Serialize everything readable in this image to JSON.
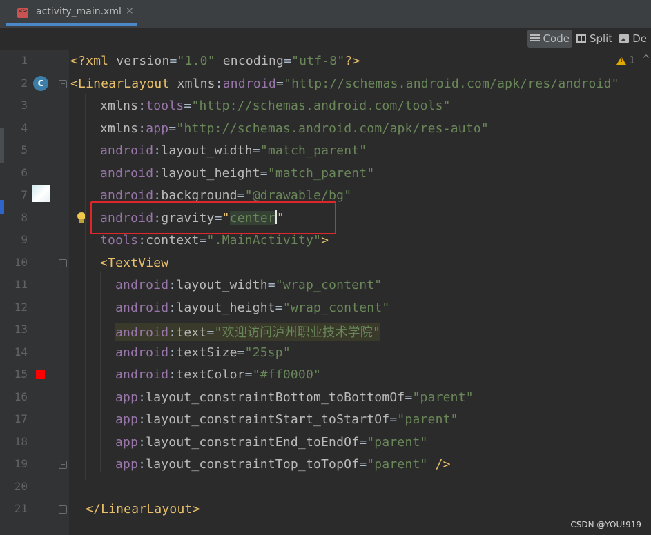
{
  "tab": {
    "filename": "activity_main.xml",
    "close": "×"
  },
  "modes": {
    "code": "Code",
    "split": "Split",
    "design": "De"
  },
  "warnings": {
    "count": "1",
    "nav": "^"
  },
  "lines": [
    {
      "n": "1",
      "tokens": [
        [
          "tk-tag",
          "<?xml "
        ],
        [
          "tk-attr",
          "version"
        ],
        [
          "tk-punc",
          "="
        ],
        [
          "tk-val",
          "\"1.0\""
        ],
        [
          "tk-attr",
          " encoding"
        ],
        [
          "tk-punc",
          "="
        ],
        [
          "tk-val",
          "\"utf-8\""
        ],
        [
          "tk-tag",
          "?>"
        ]
      ]
    },
    {
      "n": "2",
      "tokens": [
        [
          "tk-tag",
          "<LinearLayout "
        ],
        [
          "tk-attr",
          "xmlns"
        ],
        [
          "tk-punc",
          ":"
        ],
        [
          "tk-ns",
          "android"
        ],
        [
          "tk-punc",
          "="
        ],
        [
          "tk-val",
          "\"http://schemas.android.com/apk/res/android\""
        ]
      ]
    },
    {
      "n": "3",
      "tokens": [
        [
          "tk-attr",
          "xmlns"
        ],
        [
          "tk-punc",
          ":"
        ],
        [
          "tk-ns",
          "tools"
        ],
        [
          "tk-punc",
          "="
        ],
        [
          "tk-val",
          "\"http://schemas.android.com/tools\""
        ]
      ]
    },
    {
      "n": "4",
      "tokens": [
        [
          "tk-attr",
          "xmlns"
        ],
        [
          "tk-punc",
          ":"
        ],
        [
          "tk-ns",
          "app"
        ],
        [
          "tk-punc",
          "="
        ],
        [
          "tk-val",
          "\"http://schemas.android.com/apk/res-auto\""
        ]
      ]
    },
    {
      "n": "5",
      "tokens": [
        [
          "tk-ns",
          "android"
        ],
        [
          "tk-punc",
          ":"
        ],
        [
          "tk-attr",
          "layout_width"
        ],
        [
          "tk-punc",
          "="
        ],
        [
          "tk-val",
          "\"match_parent\""
        ]
      ]
    },
    {
      "n": "6",
      "tokens": [
        [
          "tk-ns",
          "android"
        ],
        [
          "tk-punc",
          ":"
        ],
        [
          "tk-attr",
          "layout_height"
        ],
        [
          "tk-punc",
          "="
        ],
        [
          "tk-val",
          "\"match_parent\""
        ]
      ]
    },
    {
      "n": "7",
      "tokens": [
        [
          "tk-ns",
          "android"
        ],
        [
          "tk-punc",
          ":"
        ],
        [
          "tk-attr",
          "background"
        ],
        [
          "tk-punc",
          "="
        ],
        [
          "tk-val",
          "\"@drawable/bg\""
        ]
      ]
    },
    {
      "n": "8",
      "tokens": [
        [
          "tk-ns",
          "android"
        ],
        [
          "tk-punc",
          ":"
        ],
        [
          "tk-attr",
          "gravity"
        ],
        [
          "tk-punc",
          "="
        ],
        [
          "tk-tag",
          "\""
        ],
        [
          "tk-val",
          "center"
        ],
        [
          "cursor",
          ""
        ],
        [
          "tk-tag",
          "\""
        ]
      ]
    },
    {
      "n": "9",
      "tokens": [
        [
          "tk-ns",
          "tools"
        ],
        [
          "tk-punc",
          ":"
        ],
        [
          "tk-attr",
          "context"
        ],
        [
          "tk-punc",
          "="
        ],
        [
          "tk-val",
          "\".MainActivity\""
        ],
        [
          "tk-tag",
          ">"
        ]
      ]
    },
    {
      "n": "10",
      "tokens": [
        [
          "tk-tag",
          "<TextView"
        ]
      ]
    },
    {
      "n": "11",
      "tokens": [
        [
          "tk-ns",
          "android"
        ],
        [
          "tk-punc",
          ":"
        ],
        [
          "tk-attr",
          "layout_width"
        ],
        [
          "tk-punc",
          "="
        ],
        [
          "tk-val",
          "\"wrap_content\""
        ]
      ]
    },
    {
      "n": "12",
      "tokens": [
        [
          "tk-ns",
          "android"
        ],
        [
          "tk-punc",
          ":"
        ],
        [
          "tk-attr",
          "layout_height"
        ],
        [
          "tk-punc",
          "="
        ],
        [
          "tk-val",
          "\"wrap_content\""
        ]
      ]
    },
    {
      "n": "13",
      "tokens": [
        [
          "tk-ns",
          "android"
        ],
        [
          "tk-punc",
          ":"
        ],
        [
          "tk-attr",
          "text"
        ],
        [
          "tk-punc",
          "="
        ],
        [
          "tk-val",
          "\"欢迎访问泸州职业技术学院\""
        ]
      ]
    },
    {
      "n": "14",
      "tokens": [
        [
          "tk-ns",
          "android"
        ],
        [
          "tk-punc",
          ":"
        ],
        [
          "tk-attr",
          "textSize"
        ],
        [
          "tk-punc",
          "="
        ],
        [
          "tk-val",
          "\"25sp\""
        ]
      ]
    },
    {
      "n": "15",
      "tokens": [
        [
          "tk-ns",
          "android"
        ],
        [
          "tk-punc",
          ":"
        ],
        [
          "tk-attr",
          "textColor"
        ],
        [
          "tk-punc",
          "="
        ],
        [
          "tk-val",
          "\"#ff0000\""
        ]
      ]
    },
    {
      "n": "16",
      "tokens": [
        [
          "tk-ns",
          "app"
        ],
        [
          "tk-punc",
          ":"
        ],
        [
          "tk-attr",
          "layout_constraintBottom_toBottomOf"
        ],
        [
          "tk-punc",
          "="
        ],
        [
          "tk-val",
          "\"parent\""
        ]
      ]
    },
    {
      "n": "17",
      "tokens": [
        [
          "tk-ns",
          "app"
        ],
        [
          "tk-punc",
          ":"
        ],
        [
          "tk-attr",
          "layout_constraintStart_toStartOf"
        ],
        [
          "tk-punc",
          "="
        ],
        [
          "tk-val",
          "\"parent\""
        ]
      ]
    },
    {
      "n": "18",
      "tokens": [
        [
          "tk-ns",
          "app"
        ],
        [
          "tk-punc",
          ":"
        ],
        [
          "tk-attr",
          "layout_constraintEnd_toEndOf"
        ],
        [
          "tk-punc",
          "="
        ],
        [
          "tk-val",
          "\"parent\""
        ]
      ]
    },
    {
      "n": "19",
      "tokens": [
        [
          "tk-ns",
          "app"
        ],
        [
          "tk-punc",
          ":"
        ],
        [
          "tk-attr",
          "layout_constraintTop_toTopOf"
        ],
        [
          "tk-punc",
          "="
        ],
        [
          "tk-val",
          "\"parent\""
        ],
        [
          "tk-tag",
          " />"
        ]
      ]
    },
    {
      "n": "20",
      "tokens": []
    },
    {
      "n": "21",
      "tokens": [
        [
          "tk-tag",
          "</LinearLayout>"
        ]
      ]
    }
  ],
  "gutter_marks": {
    "class_badge": "C"
  },
  "colors": {
    "text_color_swatch": "#ff0000",
    "highlight_box": "#e0262a"
  },
  "watermark": "CSDN @YOU!919"
}
